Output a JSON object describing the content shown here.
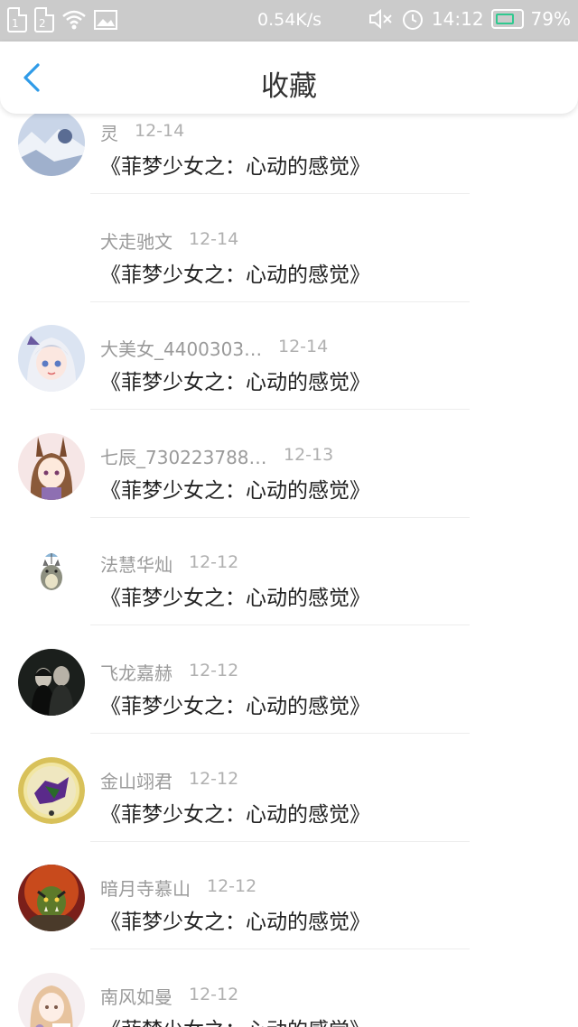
{
  "status_bar": {
    "sim1": "1",
    "sim2": "2",
    "net_speed": "0.54K/s",
    "time": "14:12",
    "battery": "79%",
    "battery_level": 0.79,
    "icons": [
      "sim-card-icon",
      "wifi-icon",
      "image-notification-icon",
      "mute-icon",
      "alarm-icon",
      "battery-icon"
    ]
  },
  "nav": {
    "back_icon": "chevron-left-icon",
    "title": "收藏",
    "accent_color": "#2f9be8"
  },
  "items": [
    {
      "name": "灵",
      "date": "12-14",
      "title": "《菲梦少女之：心动的感觉》",
      "avatar": "snow-landscape"
    },
    {
      "name": "犬走驰文",
      "date": "12-14",
      "title": "《菲梦少女之：心动的感觉》",
      "avatar": "none"
    },
    {
      "name": "大美女_4400303…",
      "date": "12-14",
      "title": "《菲梦少女之：心动的感觉》",
      "avatar": "anime-girl-silver-hair"
    },
    {
      "name": "七辰_730223788…",
      "date": "12-13",
      "title": "《菲梦少女之：心动的感觉》",
      "avatar": "anime-girl-bunny-ears"
    },
    {
      "name": "法慧华灿",
      "date": "12-12",
      "title": "《菲梦少女之：心动的感觉》",
      "avatar": "totoro"
    },
    {
      "name": "飞龙嘉赫",
      "date": "12-12",
      "title": "《菲梦少女之：心动的感觉》",
      "avatar": "dark-couple-photo"
    },
    {
      "name": "金山翊君",
      "date": "12-12",
      "title": "《菲梦少女之：心动的感觉》",
      "avatar": "game-badge-purple"
    },
    {
      "name": "暗月寺慕山",
      "date": "12-12",
      "title": "《菲梦少女之：心动的感觉》",
      "avatar": "orc-warrior"
    },
    {
      "name": "南风如曼",
      "date": "12-12",
      "title": "《菲梦少女之：心动的感觉》",
      "avatar": "anime-girl-flowers"
    }
  ]
}
